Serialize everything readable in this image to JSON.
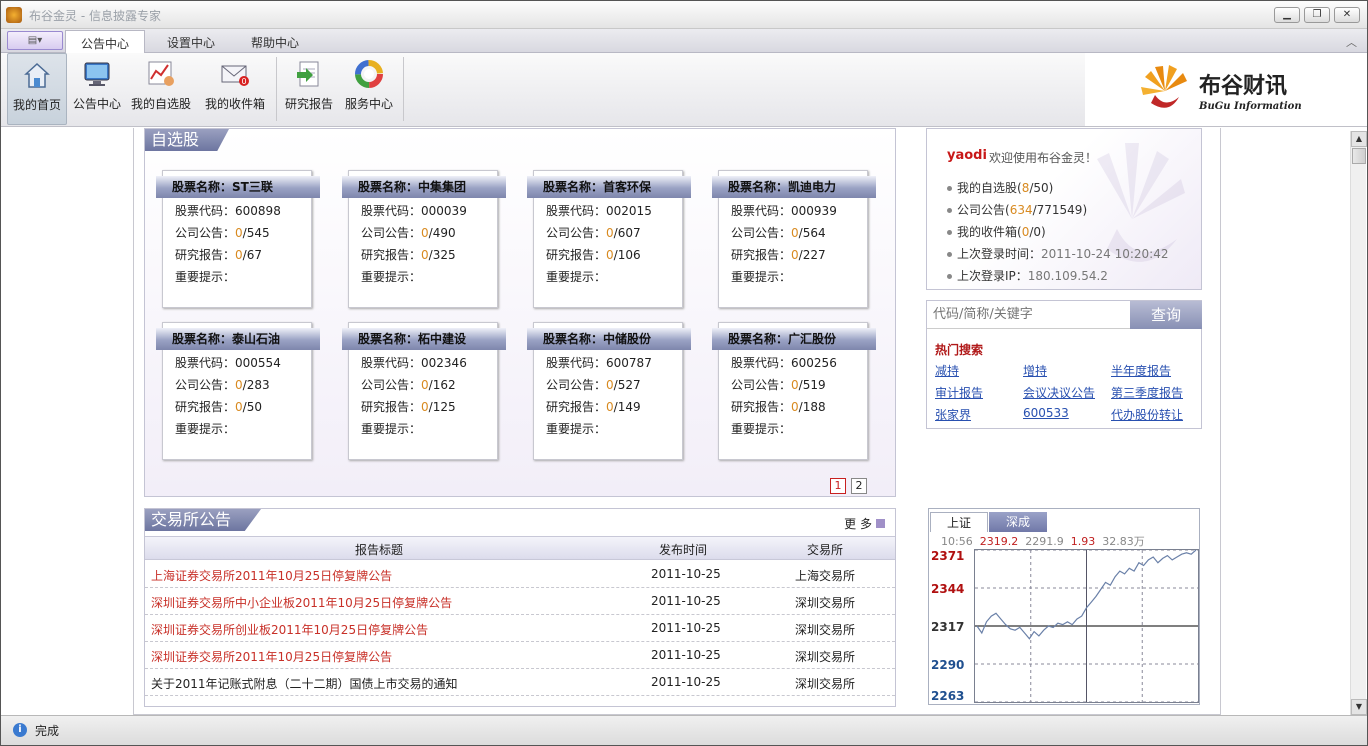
{
  "app": {
    "title": "布谷金灵 - 信息披露专家"
  },
  "tabs": [
    {
      "label": "公告中心"
    },
    {
      "label": "设置中心"
    },
    {
      "label": "帮助中心"
    }
  ],
  "toolbar": [
    {
      "label": "我的首页",
      "icon": "home-icon"
    },
    {
      "label": "公告中心",
      "icon": "monitor-icon"
    },
    {
      "label": "我的自选股",
      "icon": "stock-chart-icon"
    },
    {
      "label": "我的收件箱",
      "icon": "mail-icon"
    },
    {
      "label": "研究报告",
      "icon": "report-icon"
    },
    {
      "label": "服务中心",
      "icon": "service-ring-icon"
    }
  ],
  "logo": {
    "cn": "布谷财讯",
    "en": "BuGu Information"
  },
  "stocks": {
    "title": "自选股",
    "name_prefix": "股票名称：",
    "code_prefix": "股票代码：",
    "notice_prefix": "公司公告：",
    "report_prefix": "研究报告：",
    "tips_label": "重要提示：",
    "items": [
      {
        "name": "ST三联",
        "code": "600898",
        "notice_new": "0",
        "notice_total": "/545",
        "report_new": "0",
        "report_total": "/67"
      },
      {
        "name": "中集集团",
        "code": "000039",
        "notice_new": "0",
        "notice_total": "/490",
        "report_new": "0",
        "report_total": "/325"
      },
      {
        "name": "首客环保",
        "code": "002015",
        "notice_new": "0",
        "notice_total": "/607",
        "report_new": "0",
        "report_total": "/106"
      },
      {
        "name": "凯迪电力",
        "code": "000939",
        "notice_new": "0",
        "notice_total": "/564",
        "report_new": "0",
        "report_total": "/227"
      },
      {
        "name": "泰山石油",
        "code": "000554",
        "notice_new": "0",
        "notice_total": "/283",
        "report_new": "0",
        "report_total": "/50"
      },
      {
        "name": "柘中建设",
        "code": "002346",
        "notice_new": "0",
        "notice_total": "/162",
        "report_new": "0",
        "report_total": "/125"
      },
      {
        "name": "中储股份",
        "code": "600787",
        "notice_new": "0",
        "notice_total": "/527",
        "report_new": "0",
        "report_total": "/149"
      },
      {
        "name": "广汇股份",
        "code": "600256",
        "notice_new": "0",
        "notice_total": "/519",
        "report_new": "0",
        "report_total": "/188"
      }
    ],
    "pages": [
      "1",
      "2"
    ]
  },
  "announcements": {
    "title": "交易所公告",
    "more": "更 多",
    "headers": {
      "title": "报告标题",
      "date": "发布时间",
      "exchange": "交易所"
    },
    "rows": [
      {
        "title": "上海证券交易所2011年10月25日停复牌公告",
        "date": "2011-10-25",
        "exchange": "上海交易所",
        "highlight": true
      },
      {
        "title": "深圳证券交易所中小企业板2011年10月25日停复牌公告",
        "date": "2011-10-25",
        "exchange": "深圳交易所",
        "highlight": true
      },
      {
        "title": "深圳证券交易所创业板2011年10月25日停复牌公告",
        "date": "2011-10-25",
        "exchange": "深圳交易所",
        "highlight": true
      },
      {
        "title": "深圳证券交易所2011年10月25日停复牌公告",
        "date": "2011-10-25",
        "exchange": "深圳交易所",
        "highlight": true
      },
      {
        "title": "关于2011年记账式附息（二十二期）国债上市交易的通知",
        "date": "2011-10-25",
        "exchange": "深圳交易所",
        "highlight": false
      }
    ]
  },
  "user": {
    "name": "yaodi",
    "welcome": "欢迎使用布谷金灵！",
    "stocks_label": "我的自选股(",
    "stocks_new": "8",
    "stocks_total": "/50)",
    "notices_label": "公司公告(",
    "notices_new": "634",
    "notices_total": "/771549)",
    "inbox_label": "我的收件箱(",
    "inbox_new": "0",
    "inbox_total": "/0)",
    "last_login_label": "上次登录时间：",
    "last_login_time": "2011-10-24 10:20:42",
    "last_ip_label": "上次登录IP：",
    "last_ip": "180.109.54.2"
  },
  "search": {
    "placeholder": "代码/简称/关键字",
    "button": "查询",
    "hot_title": "热门搜索",
    "hot": [
      "减持",
      "增持",
      "半年度报告",
      "审计报告",
      "会议决议公告",
      "第三季度报告",
      "张家界",
      "600533",
      "代办股份转让"
    ]
  },
  "market": {
    "tabs": [
      "上证",
      "深成"
    ],
    "time": "10:56",
    "price": "2319.2",
    "prev": "2291.9",
    "change": "1.93",
    "volume": "32.83万",
    "y_labels": [
      "2371",
      "2344",
      "2317",
      "2290",
      "2263"
    ]
  },
  "chart_data": {
    "type": "line",
    "title": "",
    "ylim": [
      2263,
      2371
    ],
    "series": [
      {
        "values": [
          2317,
          2312,
          2320,
          2324,
          2326,
          2322,
          2318,
          2315,
          2314,
          2316,
          2312,
          2308,
          2313,
          2310,
          2314,
          2317,
          2316,
          2319,
          2318,
          2320,
          2318,
          2322,
          2324,
          2330,
          2334,
          2338,
          2343,
          2348,
          2346,
          2352,
          2356,
          2354,
          2358,
          2356,
          2362,
          2360,
          2364,
          2366,
          2362,
          2365,
          2367,
          2364,
          2366,
          2368,
          2369,
          2368,
          2371
        ]
      }
    ]
  },
  "status": {
    "text": "完成"
  },
  "colors": {
    "accent": "#7e86ac",
    "new_count": "#d88a20",
    "highlight": "#c83028"
  }
}
